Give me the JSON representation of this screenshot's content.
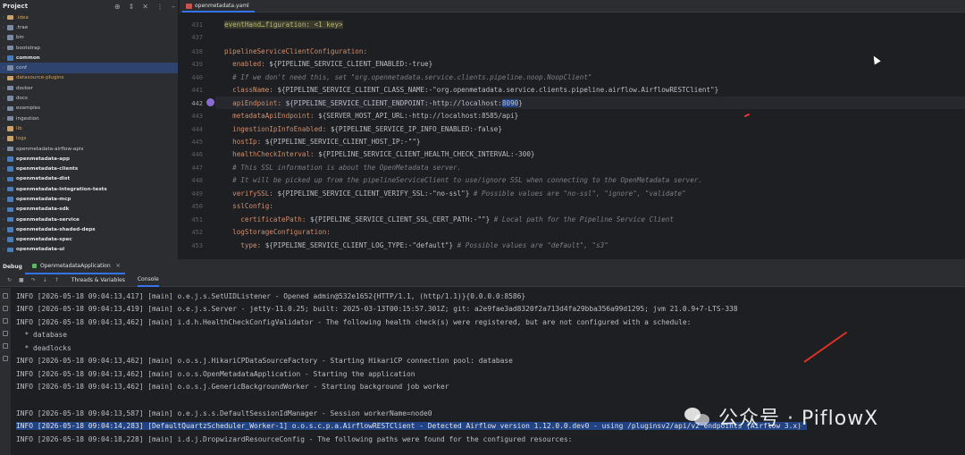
{
  "project": {
    "title": "Project",
    "items": [
      {
        "label": ".idea",
        "kind": "folder",
        "style": "orange"
      },
      {
        "label": ".trae",
        "kind": "folder"
      },
      {
        "label": "bin",
        "kind": "folder"
      },
      {
        "label": "bootstrap",
        "kind": "folder"
      },
      {
        "label": "common",
        "kind": "module",
        "style": "bold"
      },
      {
        "label": "conf",
        "kind": "folder",
        "selected": true
      },
      {
        "label": "datasource-plugins",
        "kind": "folder",
        "style": "orange"
      },
      {
        "label": "docker",
        "kind": "folder"
      },
      {
        "label": "docs",
        "kind": "folder"
      },
      {
        "label": "examples",
        "kind": "folder"
      },
      {
        "label": "ingestion",
        "kind": "folder"
      },
      {
        "label": "lib",
        "kind": "folder",
        "style": "orange"
      },
      {
        "label": "logs",
        "kind": "folder",
        "style": "orange"
      },
      {
        "label": "openmetadata-airflow-apis",
        "kind": "folder"
      },
      {
        "label": "openmetadata-app",
        "kind": "module",
        "style": "bold"
      },
      {
        "label": "openmetadata-clients",
        "kind": "module",
        "style": "bold"
      },
      {
        "label": "openmetadata-dist",
        "kind": "module",
        "style": "bold"
      },
      {
        "label": "openmetadata-integration-tests",
        "kind": "module",
        "style": "bold"
      },
      {
        "label": "openmetadata-mcp",
        "kind": "module",
        "style": "bold"
      },
      {
        "label": "openmetadata-sdk",
        "kind": "module",
        "style": "bold"
      },
      {
        "label": "openmetadata-service",
        "kind": "module",
        "style": "bold"
      },
      {
        "label": "openmetadata-shaded-deps",
        "kind": "module",
        "style": "bold"
      },
      {
        "label": "openmetadata-spec",
        "kind": "module",
        "style": "bold"
      },
      {
        "label": "openmetadata-ui",
        "kind": "module",
        "style": "bold"
      }
    ]
  },
  "editor": {
    "tab": "openmetadata.yaml",
    "lines": [
      {
        "num": "431",
        "text": "eventHand…figuration: <1 key>"
      },
      {
        "num": "437",
        "text": ""
      },
      {
        "num": "438",
        "text": "pipelineServiceClientConfiguration:"
      },
      {
        "num": "439",
        "text": "  enabled: ${PIPELINE_SERVICE_CLIENT_ENABLED:-true}"
      },
      {
        "num": "440",
        "text": "  # If we don't need this, set \"org.openmetadata.service.clients.pipeline.noop.NoopClient\""
      },
      {
        "num": "441",
        "text": "  className: ${PIPELINE_SERVICE_CLIENT_CLASS_NAME:-\"org.openmetadata.service.clients.pipeline.airflow.AirflowRESTClient\"}"
      },
      {
        "num": "442",
        "text": "  apiEndpoint: ${PIPELINE_SERVICE_CLIENT_ENDPOINT:-http://localhost:8090}"
      },
      {
        "num": "443",
        "text": "  metadataApiEndpoint: ${SERVER_HOST_API_URL:-http://localhost:8585/api}"
      },
      {
        "num": "444",
        "text": "  ingestionIpInfoEnabled: ${PIPELINE_SERVICE_IP_INFO_ENABLED:-false}"
      },
      {
        "num": "445",
        "text": "  hostIp: ${PIPELINE_SERVICE_CLIENT_HOST_IP:-\"\"}"
      },
      {
        "num": "446",
        "text": "  healthCheckInterval: ${PIPELINE_SERVICE_CLIENT_HEALTH_CHECK_INTERVAL:-300}"
      },
      {
        "num": "447",
        "text": "  # This SSL information is about the OpenMetadata server."
      },
      {
        "num": "448",
        "text": "  # It will be picked up from the pipelineServiceClient to use/ignore SSL when connecting to the OpenMetadata server."
      },
      {
        "num": "449",
        "text": "  verifySSL: ${PIPELINE_SERVICE_CLIENT_VERIFY_SSL:-\"no-ssl\"} # Possible values are \"no-ssl\", \"ignore\", \"validate\""
      },
      {
        "num": "450",
        "text": "  sslConfig:"
      },
      {
        "num": "451",
        "text": "    certificatePath: ${PIPELINE_SERVICE_CLIENT_SSL_CERT_PATH:-\"\"} # Local path for the Pipeline Service Client"
      },
      {
        "num": "452",
        "text": "  logStorageConfiguration:"
      },
      {
        "num": "453",
        "text": "    type: ${PIPELINE_SERVICE_CLIENT_LOG_TYPE:-\"default\"} # Possible values are \"default\", \"s3\""
      }
    ]
  },
  "debug": {
    "title": "Debug",
    "session": "OpenmetadataApplication",
    "tabs": [
      "Threads & Variables",
      "Console"
    ],
    "active_tab": "Console"
  },
  "console": {
    "lines": [
      "INFO [2026-05-18 09:04:13,417] [main] o.e.j.s.SetUIDListener - Opened admin@532e1652{HTTP/1.1, (http/1.1)}{0.0.0.0:8586}",
      "INFO [2026-05-18 09:04:13,419] [main] o.e.j.s.Server - jetty-11.0.25; built: 2025-03-13T00:15:57.301Z; git: a2e9fae3ad8320f2a713d4fa29bba356a99d1295; jvm 21.0.9+7-LTS-338",
      "INFO [2026-05-18 09:04:13,462] [main] i.d.h.HealthCheckConfigValidator - The following health check(s) were registered, but are not configured with a schedule:",
      "  * database",
      "  * deadlocks",
      "INFO [2026-05-18 09:04:13,462] [main] o.o.s.j.HikariCPDataSourceFactory - Starting HikariCP connection pool: database",
      "INFO [2026-05-18 09:04:13,462] [main] o.o.s.OpenMetadataApplication - Starting the application",
      "INFO [2026-05-18 09:04:13,462] [main] o.o.s.j.GenericBackgroundWorker - Starting background job worker",
      "",
      "INFO [2026-05-18 09:04:13,587] [main] o.e.j.s.s.DefaultSessionIdManager - Session workerName=node0",
      "INFO [2026-05-18 09:04:14,283] [DefaultQuartzScheduler_Worker-1] o.o.s.c.p.a.AirflowRESTClient - Detected Airflow version 1.12.0.0.dev0 - using /pluginsv2/api/v2 endpoints (Airflow 3.x)",
      "INFO [2026-05-18 09:04:18,228] [main] i.d.j.DropwizardResourceConfig - The following paths were found for the configured resources:"
    ],
    "selected_index": 10
  },
  "watermark": {
    "text": "公众号 · PiflowX"
  }
}
